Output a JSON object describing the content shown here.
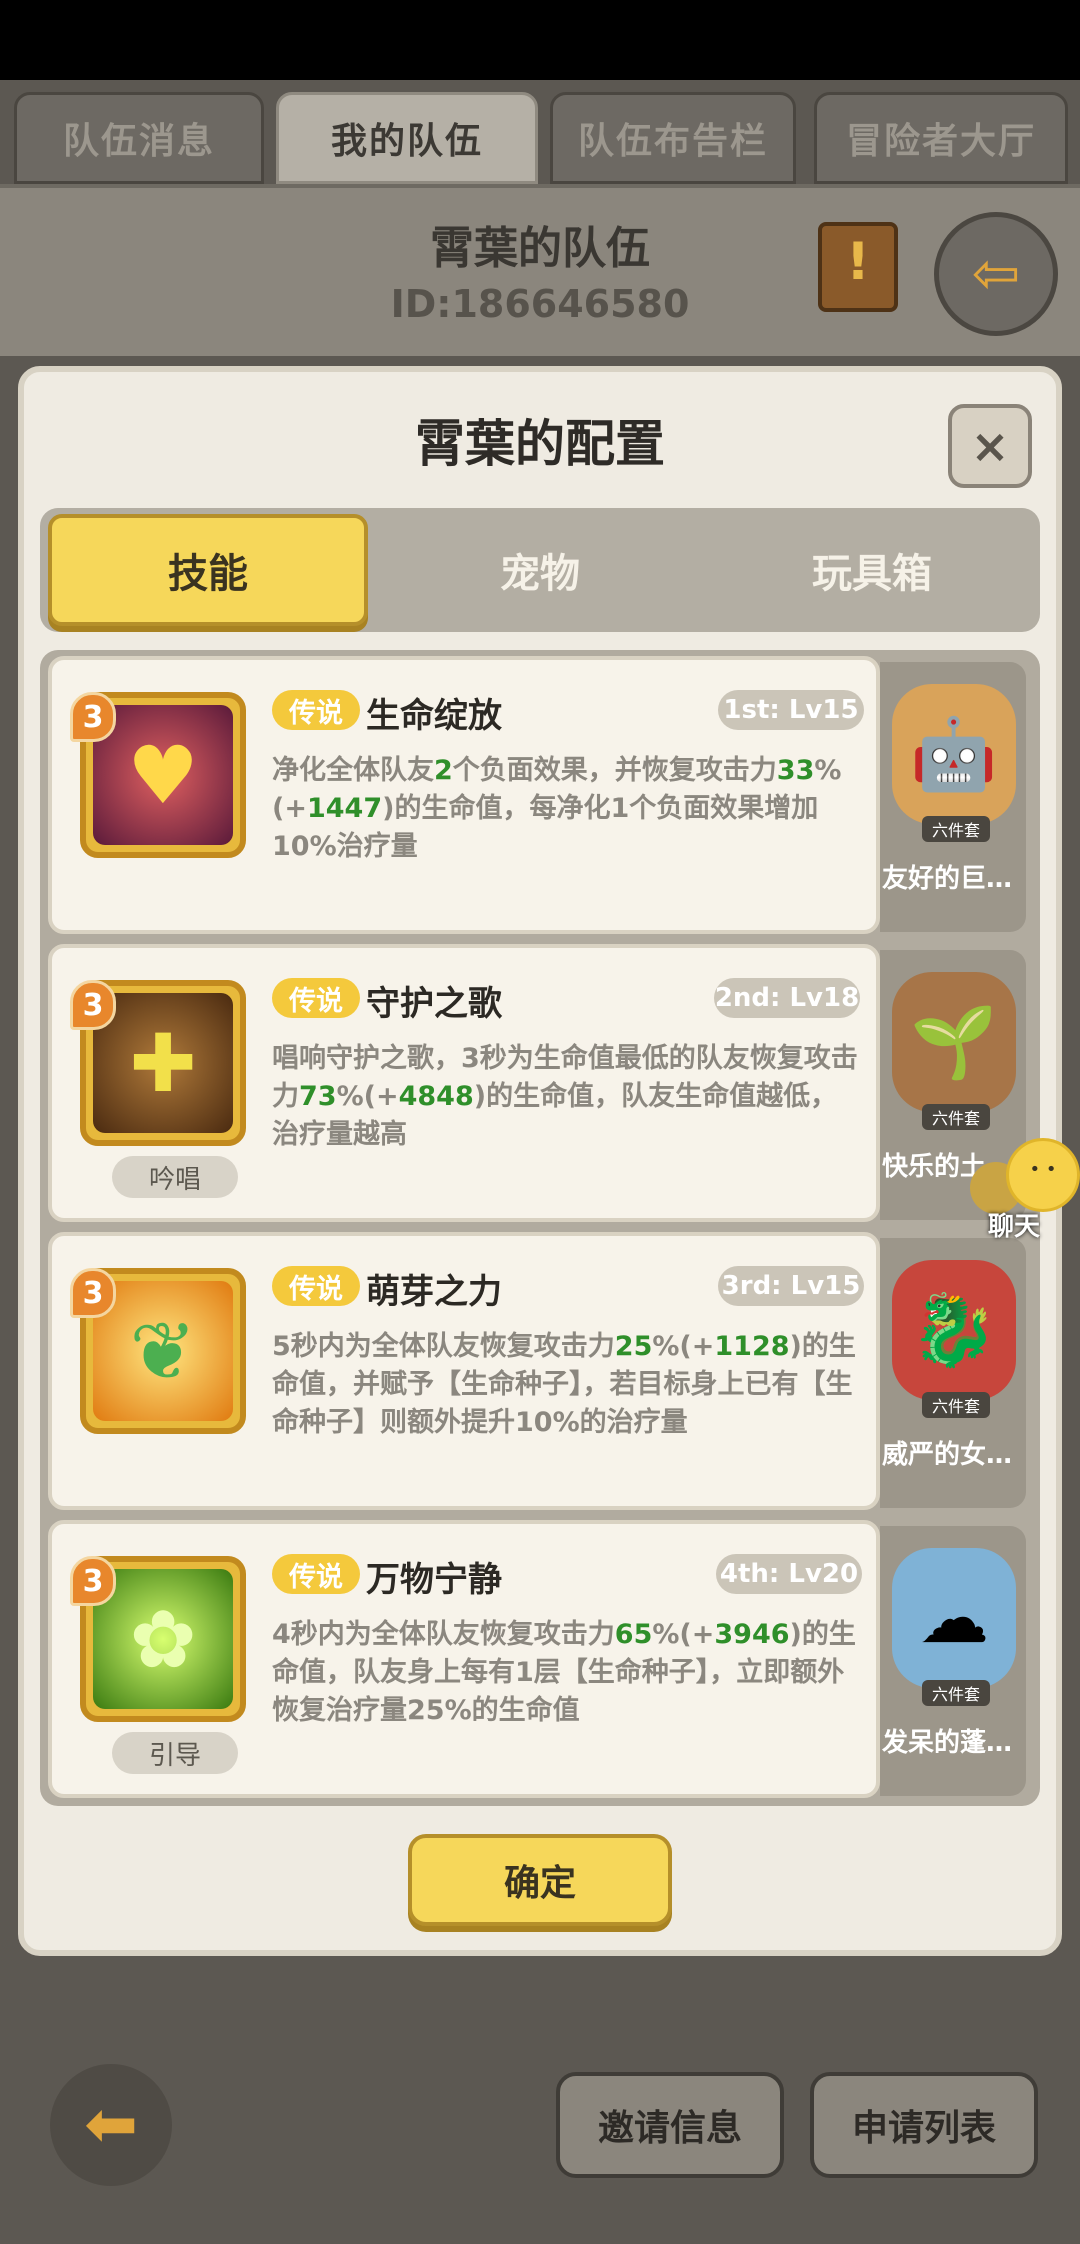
{
  "tabs": [
    "队伍消息",
    "我的队伍",
    "队伍布告栏",
    "冒险者大厅"
  ],
  "team": {
    "name": "霄葉的队伍",
    "id": "ID:186646580"
  },
  "panel": {
    "title": "霄葉的配置",
    "close": "×",
    "segments": [
      "技能",
      "宠物",
      "玩具箱"
    ],
    "confirm": "确定"
  },
  "skills": [
    {
      "level": "3",
      "rarity": "传说",
      "name": "生命绽放",
      "slot": "1st: Lv15",
      "tag": "",
      "desc_parts": [
        "净化全体队友",
        "2",
        "个负面效果，并恢复攻击力",
        "33",
        "%(+",
        "1447",
        ")的生命值，每净化1个负面效果增加10%治疗量"
      ]
    },
    {
      "level": "3",
      "rarity": "传说",
      "name": "守护之歌",
      "slot": "2nd: Lv18",
      "tag": "吟唱",
      "desc_parts": [
        "唱响守护之歌，3秒为生命值最低的队友恢复攻击力",
        "73",
        "%(+",
        "4848",
        ")的生命值，队友生命值越低，治疗量越高"
      ]
    },
    {
      "level": "3",
      "rarity": "传说",
      "name": "萌芽之力",
      "slot": "3rd: Lv15",
      "tag": "",
      "desc_parts": [
        "5秒内为全体队友恢复攻击力",
        "25",
        "%(+",
        "1128",
        ")的生命值，并赋予【生命种子】，若目标身上已有【生命种子】则额外提升10%的治疗量"
      ]
    },
    {
      "level": "3",
      "rarity": "传说",
      "name": "万物宁静",
      "slot": "4th: Lv20",
      "tag": "引导",
      "desc_parts": [
        "4秒内为全体队友恢复攻击力",
        "65",
        "%(+",
        "3946",
        ")的生命值，队友身上每有1层【生命种子】，立即额外恢复治疗量25%的生命值"
      ]
    }
  ],
  "pets": [
    {
      "set": "六件套",
      "name": "友好的巨…",
      "icon": "robot-pet-icon"
    },
    {
      "set": "六件套",
      "name": "快乐的土…",
      "icon": "sprout-pet-icon"
    },
    {
      "set": "六件套",
      "name": "威严的女…",
      "icon": "dragon-pet-icon"
    },
    {
      "set": "六件套",
      "name": "发呆的蓬…",
      "icon": "fluffy-pet-icon"
    }
  ],
  "chat": {
    "label": "聊天"
  },
  "bottom": {
    "invite": "邀请信息",
    "apply": "申请列表"
  }
}
